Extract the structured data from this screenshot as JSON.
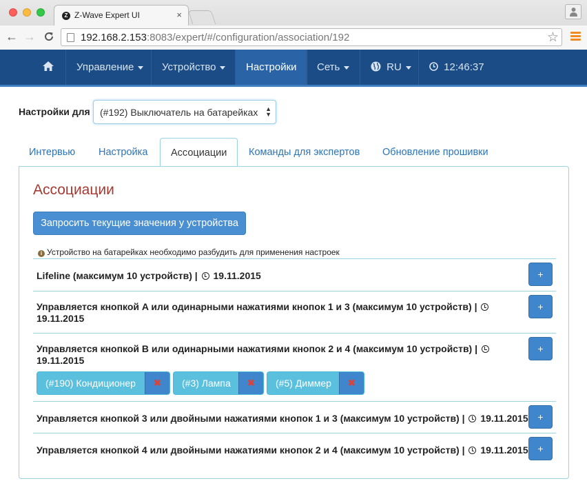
{
  "browser": {
    "tab_title": "Z-Wave Expert UI",
    "tab_close": "×",
    "url_host": "192.168.2.153",
    "url_rest": ":8083/expert/#/configuration/association/192",
    "back": "←",
    "forward": "→",
    "reload": "C",
    "star": "☆"
  },
  "navbar": {
    "home": "⌂",
    "items": [
      {
        "label": "Управление"
      },
      {
        "label": "Устройство"
      },
      {
        "label": "Настройки"
      },
      {
        "label": "Сеть"
      },
      {
        "label": "RU"
      },
      {
        "label": "12:46:37"
      }
    ]
  },
  "device": {
    "label": "Настройки для",
    "selected": "(#192) Выключатель на батарейках"
  },
  "tabs": [
    {
      "label": "Интервью"
    },
    {
      "label": "Настройка"
    },
    {
      "label": "Ассоциации"
    },
    {
      "label": "Команды для экспертов"
    },
    {
      "label": "Обновление прошивки"
    }
  ],
  "panel": {
    "title": "Ассоциации",
    "query_button": "Запросить текущие значения у устройства",
    "note": "Устройство на батарейках необходимо разбудить для применения настроек",
    "note_icon": "i",
    "plus": "+",
    "delete": "✖"
  },
  "groups": [
    {
      "text1": "Lifeline (максимум 10 устройств) |",
      "date": "19.11.2015"
    },
    {
      "text1": "Управляется кнопкой A или одинарными нажатиями кнопок 1 и 3 (максимум 10 устройств) |",
      "date": "19.11.2015"
    },
    {
      "text1": "Управляется кнопкой B или одинарными нажатиями кнопок 2 и 4 (максимум 10 устройств) |",
      "date": "19.11.2015"
    },
    {
      "text1": "Управляется кнопкой 3 или двойными нажатиями кнопок 1 и 3 (максимум 10 устройств) |",
      "date": "19.11.2015"
    },
    {
      "text1": "Управляется кнопкой 4 или двойными нажатиями кнопок 2 и 4 (максимум 10 устройств) |",
      "date": "19.11.2015"
    }
  ],
  "chips": [
    {
      "label": "(#190) Кондиционер"
    },
    {
      "label": "(#3) Лампа"
    },
    {
      "label": "(#5) Диммер"
    }
  ],
  "colors": {
    "navbar": "#1b4c85",
    "navbar_active": "#2a64a6",
    "primary_button": "#4a8fd1",
    "chip": "#5bc0de",
    "title": "#a33a32",
    "border": "#9ad3e6"
  }
}
